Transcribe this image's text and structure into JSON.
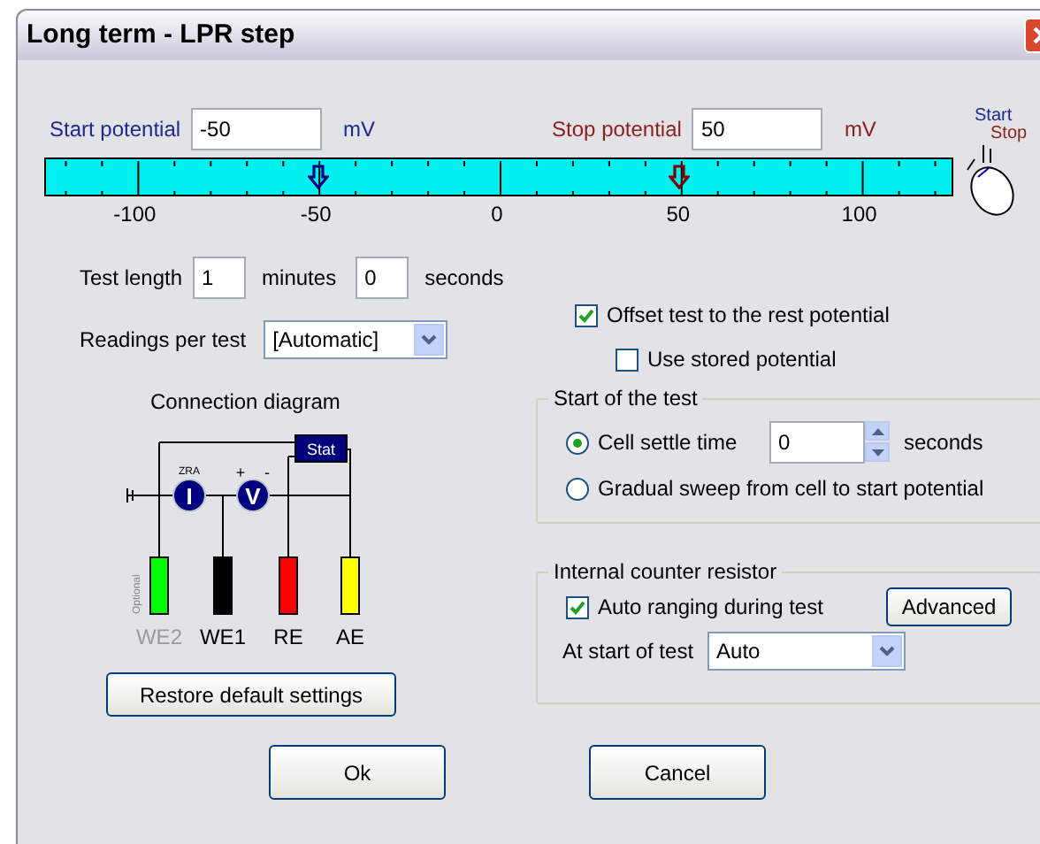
{
  "window": {
    "title": "Long term - LPR step"
  },
  "potentials": [
    {
      "kind": "start",
      "label": "Start potential",
      "value": "-50",
      "unit": "mV"
    },
    {
      "kind": "stop",
      "label": "Stop potential",
      "value": "50",
      "unit": "mV"
    }
  ],
  "scale": {
    "ticks": [
      "-100",
      "-50",
      "0",
      "50",
      "100"
    ],
    "markers": [
      {
        "kind": "start",
        "level": 0.3
      },
      {
        "kind": "stop",
        "level": 0.7
      }
    ]
  },
  "mouse_hint": {
    "start": "Start",
    "stop": "Stop"
  },
  "test_length": {
    "label": "Test length",
    "minutes": "1",
    "minutes_unit": "minutes",
    "seconds": "0",
    "seconds_unit": "seconds"
  },
  "readings": {
    "label": "Readings per test",
    "value": "[Automatic]"
  },
  "diagram": {
    "title": "Connection diagram",
    "stat": "Stat",
    "zra": "ZRA",
    "ammeter": "I",
    "voltmeter": "V",
    "plus": "+",
    "minus": "-",
    "optional": "Optional",
    "leads": [
      {
        "label": "WE2",
        "color": "#00ff00",
        "disabled": true
      },
      {
        "label": "WE1",
        "color": "#000000",
        "disabled": false
      },
      {
        "label": "RE",
        "color": "#ff0000",
        "disabled": false
      },
      {
        "label": "AE",
        "color": "#ffff00",
        "disabled": false
      }
    ]
  },
  "restore_button": "Restore default settings",
  "offset": {
    "label": "Offset test to the rest potential",
    "checked": true
  },
  "stored": {
    "label": "Use stored potential",
    "checked": false
  },
  "start_group": {
    "title": "Start of the test",
    "options": [
      {
        "kind": "spin",
        "label": "Cell settle time",
        "selected": true,
        "value": "0",
        "unit": "seconds"
      },
      {
        "kind": "plain",
        "label": "Gradual sweep from cell to start potential",
        "selected": false
      }
    ]
  },
  "resistor_group": {
    "title": "Internal counter resistor",
    "auto": {
      "label": "Auto ranging during test",
      "checked": true
    },
    "advanced": "Advanced",
    "start_label": "At start of test",
    "start_value": "Auto"
  },
  "buttons": [
    "Ok",
    "Cancel"
  ]
}
